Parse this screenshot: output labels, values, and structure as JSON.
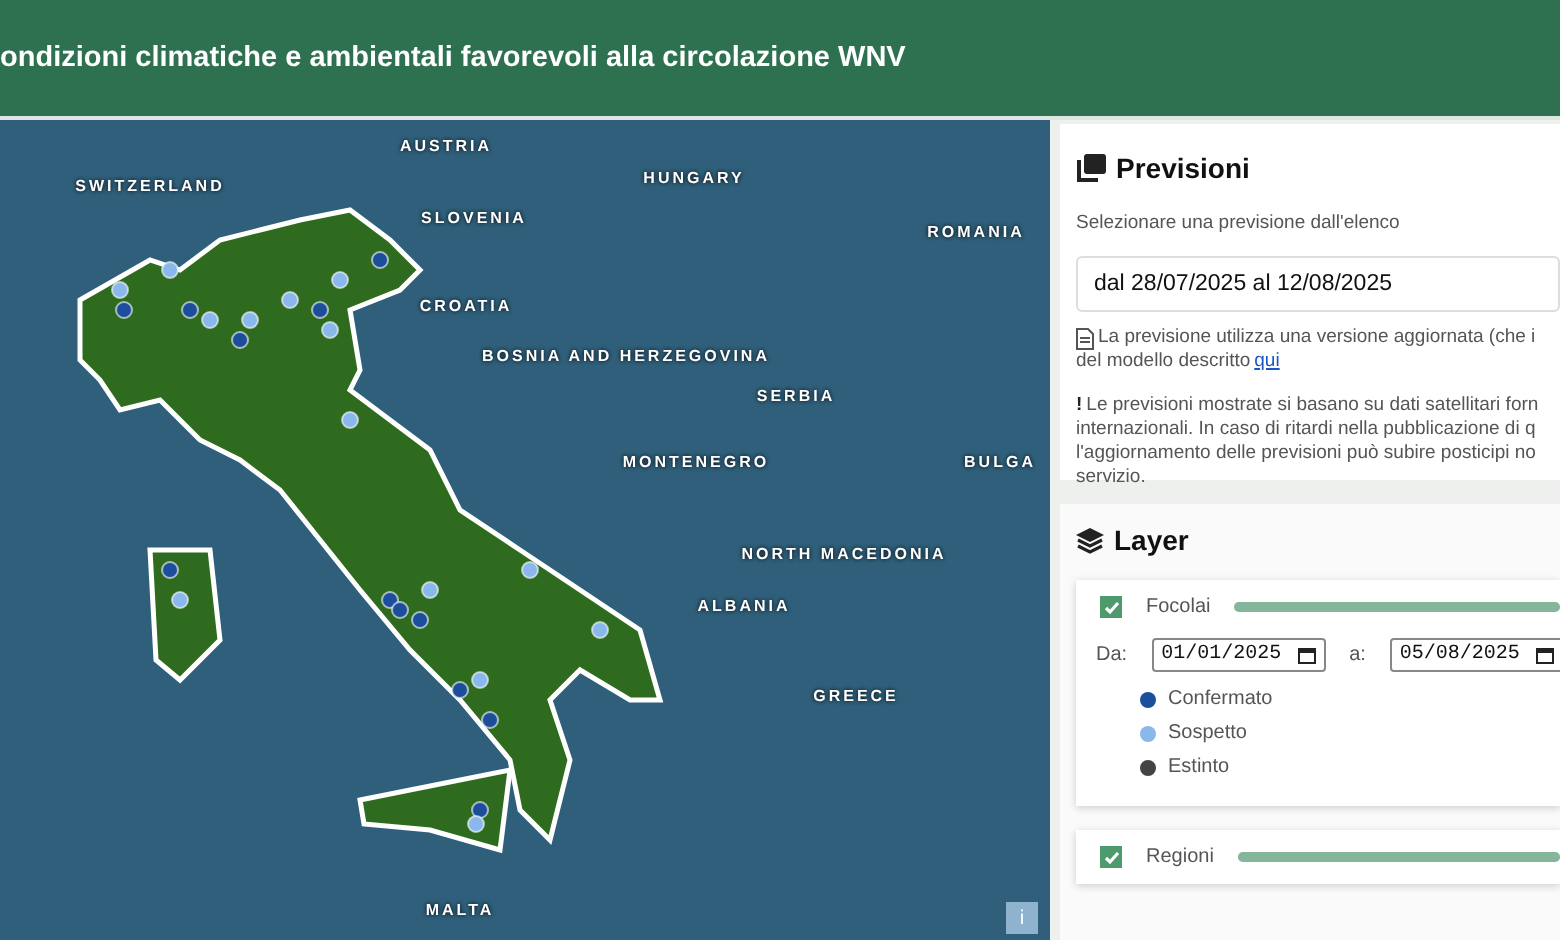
{
  "header": {
    "title": "ondizioni climatiche e ambientali favorevoli alla circolazione WNV"
  },
  "map": {
    "labels": [
      {
        "text": "AUSTRIA"
      },
      {
        "text": "SWITZERLAND"
      },
      {
        "text": "SLOVENIA"
      },
      {
        "text": "HUNGARY"
      },
      {
        "text": "ROMANIA"
      },
      {
        "text": "CROATIA"
      },
      {
        "text": "BOSNIA AND HERZEGOVINA"
      },
      {
        "text": "SERBIA"
      },
      {
        "text": "MONTENEGRO"
      },
      {
        "text": "BULGA"
      },
      {
        "text": "NORTH MACEDONIA"
      },
      {
        "text": "ALBANIA"
      },
      {
        "text": "GREECE"
      },
      {
        "text": "MALTA"
      }
    ],
    "info_button": "i"
  },
  "forecast": {
    "title": "Previsioni",
    "hint": "Selezionare una previsione dall'elenco",
    "selected_option": "dal 28/07/2025 al 12/08/2025",
    "note_lines": [
      "La previsione utilizza una versione aggiornata (che i",
      "del modello descritto "
    ],
    "note_link": "qui",
    "warning_mark": "!",
    "warning_lines": [
      "Le previsioni mostrate si basano su dati satellitari forn",
      "internazionali. In caso di ritardi nella pubblicazione di q",
      "l'aggiornamento delle previsioni può subire posticipi no",
      "servizio."
    ]
  },
  "layers": {
    "title": "Layer",
    "items": [
      {
        "label": "Focolai",
        "checked": true,
        "level": 1,
        "from_label": "Da:",
        "from": "01/01/2025",
        "to_label": "a:",
        "to": "05/08/2025",
        "legend": [
          {
            "label": "Confermato",
            "color": "#1d4e9c"
          },
          {
            "label": "Sospetto",
            "color": "#8ab8ec"
          },
          {
            "label": "Estinto",
            "color": "#444444"
          }
        ]
      },
      {
        "label": "Regioni",
        "checked": true,
        "level": 1
      }
    ]
  }
}
